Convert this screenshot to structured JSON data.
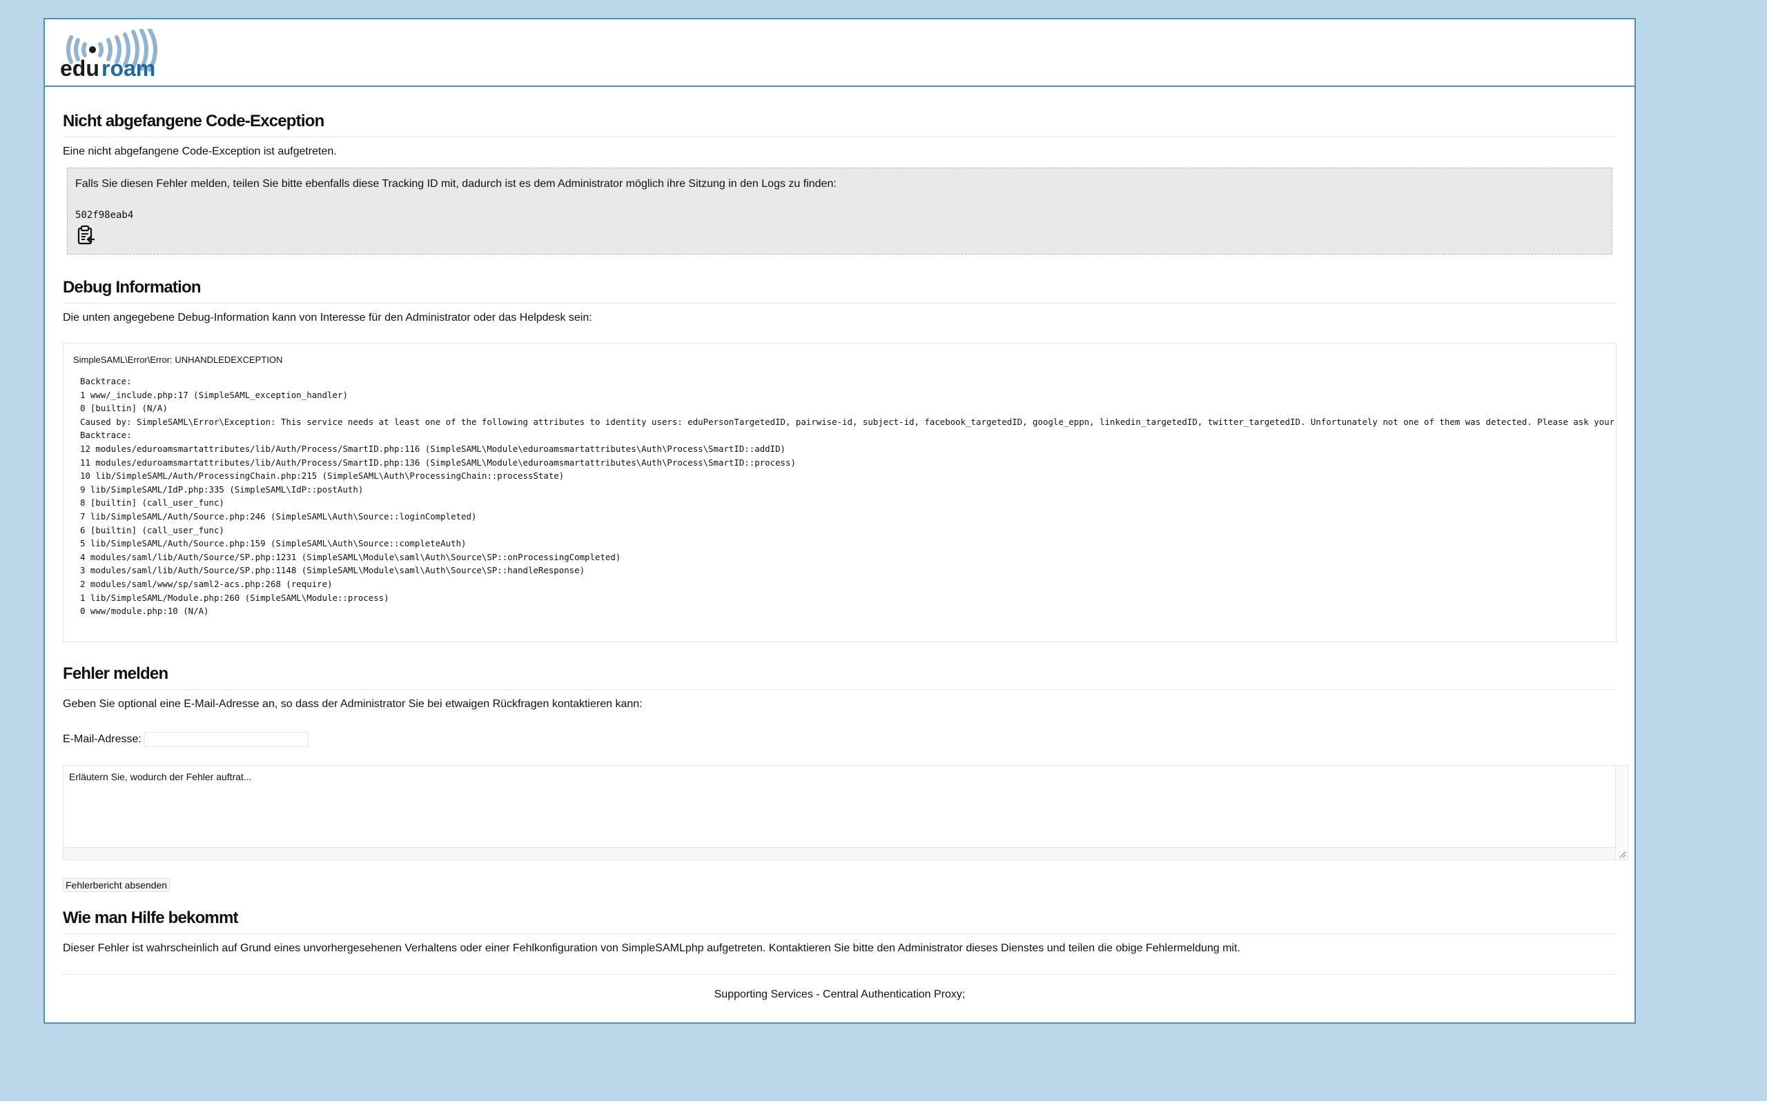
{
  "header": {
    "logo_text": "eduroam"
  },
  "exception": {
    "title": "Nicht abgefangene Code-Exception",
    "description": "Eine nicht abgefangene Code-Exception ist aufgetreten.",
    "tracking_text": "Falls Sie diesen Fehler melden, teilen Sie bitte ebenfalls diese Tracking ID mit, dadurch ist es dem Administrator möglich ihre Sitzung in den Logs zu finden:",
    "tracking_id": "502f98eab4",
    "copy_icon": "clipboard-icon"
  },
  "debug": {
    "title": "Debug Information",
    "description": "Die unten angegebene Debug-Information kann von Interesse für den Administrator oder das Helpdesk sein:",
    "error_name": "SimpleSAML\\Error\\Error: UNHANDLEDEXCEPTION",
    "backtrace": "Backtrace:\n1 www/_include.php:17 (SimpleSAML_exception_handler)\n0 [builtin] (N/A)\nCaused by: SimpleSAML\\Error\\Exception: This service needs at least one of the following attributes to identity users: eduPersonTargetedID, pairwise-id, subject-id, facebook_targetedID, google_eppn, linkedin_targetedID, twitter_targetedID. Unfortunately not one of them was detected. Please ask your institution\nBacktrace:\n12 modules/eduroamsmartattributes/lib/Auth/Process/SmartID.php:116 (SimpleSAML\\Module\\eduroamsmartattributes\\Auth\\Process\\SmartID::addID)\n11 modules/eduroamsmartattributes/lib/Auth/Process/SmartID.php:136 (SimpleSAML\\Module\\eduroamsmartattributes\\Auth\\Process\\SmartID::process)\n10 lib/SimpleSAML/Auth/ProcessingChain.php:215 (SimpleSAML\\Auth\\ProcessingChain::processState)\n9 lib/SimpleSAML/IdP.php:335 (SimpleSAML\\IdP::postAuth)\n8 [builtin] (call_user_func)\n7 lib/SimpleSAML/Auth/Source.php:246 (SimpleSAML\\Auth\\Source::loginCompleted)\n6 [builtin] (call_user_func)\n5 lib/SimpleSAML/Auth/Source.php:159 (SimpleSAML\\Auth\\Source::completeAuth)\n4 modules/saml/lib/Auth/Source/SP.php:1231 (SimpleSAML\\Module\\saml\\Auth\\Source\\SP::onProcessingCompleted)\n3 modules/saml/lib/Auth/Source/SP.php:1148 (SimpleSAML\\Module\\saml\\Auth\\Source\\SP::handleResponse)\n2 modules/saml/www/sp/saml2-acs.php:268 (require)\n1 lib/SimpleSAML/Module.php:260 (SimpleSAML\\Module::process)\n0 www/module.php:10 (N/A)"
  },
  "report": {
    "title": "Fehler melden",
    "description": "Geben Sie optional eine E-Mail-Adresse an, so dass der Administrator Sie bei etwaigen Rückfragen kontaktieren kann:",
    "email_label": "E-Mail-Adresse:",
    "email_value": "",
    "textarea_value": "Erläutern Sie, wodurch der Fehler auftrat...",
    "send_label": "Fehlerbericht absenden"
  },
  "help": {
    "title": "Wie man Hilfe bekommt",
    "description": "Dieser Fehler ist wahrscheinlich auf Grund eines unvorhergesehenen Verhaltens oder einer Fehlkonfiguration von SimpleSAMLphp aufgetreten. Kontaktieren Sie bitte den Administrator dieses Dienstes und teilen die obige Fehlermeldung mit."
  },
  "footer": {
    "text": "Supporting Services - Central Authentication Proxy;"
  },
  "colors": {
    "background": "#bdd7ea",
    "frame_border": "#4f8fb8",
    "logo_blue": "#1b6aa5",
    "logo_dark": "#1a1a1a",
    "tracking_bg": "#e9e9e9"
  }
}
